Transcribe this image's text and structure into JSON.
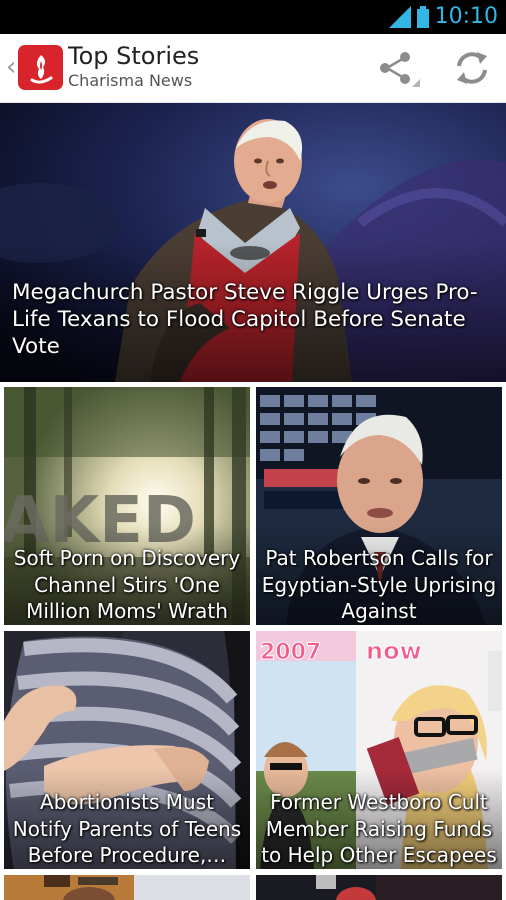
{
  "status_bar": {
    "time": "10:10"
  },
  "action_bar": {
    "title": "Top Stories",
    "subtitle": "Charisma News",
    "share_icon": "share-icon",
    "refresh_icon": "refresh-icon"
  },
  "colors": {
    "accent": "#33b5e5",
    "brand_red": "#d8252b"
  },
  "featured": {
    "headline": "Megachurch Pastor Steve Riggle Urges Pro-Life Texans to Flood Capitol Before Senate Vote"
  },
  "stories": [
    {
      "headline": "Soft Porn on Discovery Channel Stirs 'One Million Moms' Wrath",
      "image_text": "AKED"
    },
    {
      "headline": "Pat Robertson Calls for Egyptian-Style Uprising Against"
    },
    {
      "headline": "Abortionists Must Notify Parents of Teens Before Procedure,…"
    },
    {
      "headline": "Former Westboro Cult Member Raising Funds to Help Other Escapees",
      "image_text": [
        "2007",
        "now"
      ]
    }
  ]
}
